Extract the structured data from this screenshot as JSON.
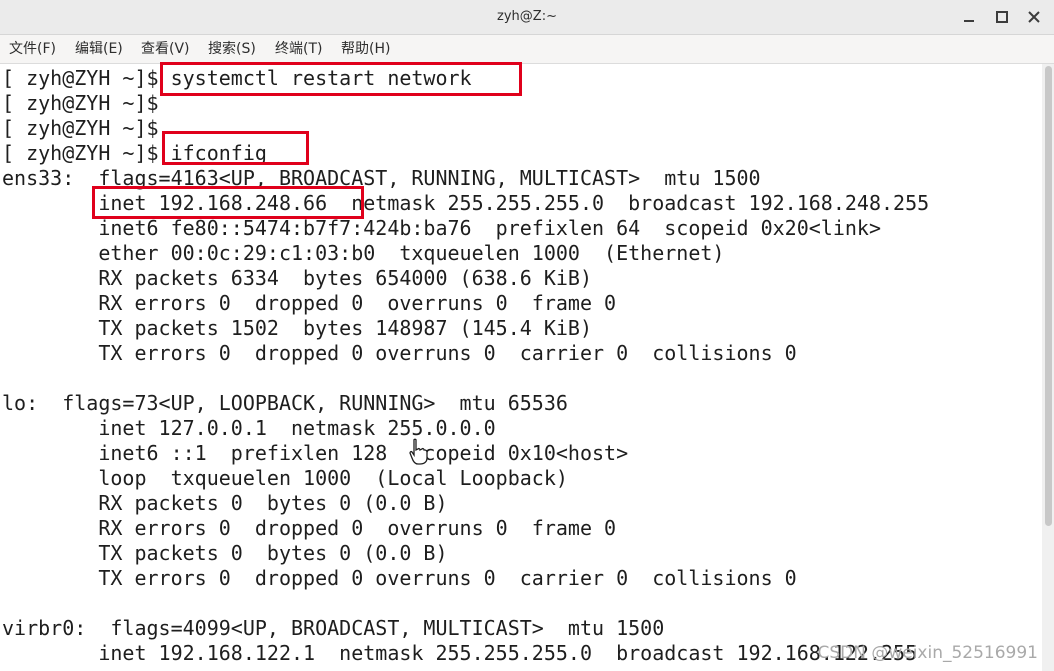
{
  "window": {
    "title": "zyh@Z:~"
  },
  "menu": [
    "文件(F)",
    "编辑(E)",
    "查看(V)",
    "搜索(S)",
    "终端(T)",
    "帮助(H)"
  ],
  "terminal": {
    "lines": [
      "[ zyh@ZYH ~]$ systemctl restart network",
      "[ zyh@ZYH ~]$",
      "[ zyh@ZYH ~]$",
      "[ zyh@ZYH ~]$ ifconfig",
      "ens33:  flags=4163<UP, BROADCAST, RUNNING, MULTICAST>  mtu 1500",
      "        inet 192.168.248.66  netmask 255.255.255.0  broadcast 192.168.248.255",
      "        inet6 fe80::5474:b7f7:424b:ba76  prefixlen 64  scopeid 0x20<link>",
      "        ether 00:0c:29:c1:03:b0  txqueuelen 1000  (Ethernet)",
      "        RX packets 6334  bytes 654000 (638.6 KiB)",
      "        RX errors 0  dropped 0  overruns 0  frame 0",
      "        TX packets 1502  bytes 148987 (145.4 KiB)",
      "        TX errors 0  dropped 0 overruns 0  carrier 0  collisions 0",
      "",
      "lo:  flags=73<UP, LOOPBACK, RUNNING>  mtu 65536",
      "        inet 127.0.0.1  netmask 255.0.0.0",
      "        inet6 ::1  prefixlen 128  scopeid 0x10<host>",
      "        loop  txqueuelen 1000  (Local Loopback)",
      "        RX packets 0  bytes 0 (0.0 B)",
      "        RX errors 0  dropped 0  overruns 0  frame 0",
      "        TX packets 0  bytes 0 (0.0 B)",
      "        TX errors 0  dropped 0 overruns 0  carrier 0  collisions 0",
      "",
      "virbr0:  flags=4099<UP, BROADCAST, MULTICAST>  mtu 1500",
      "        inet 192.168.122.1  netmask 255.255.255.0  broadcast 192.168.122.255"
    ]
  },
  "watermark": "CSDN @weixin_52516991",
  "colors": {
    "highlight": "#e0001b",
    "text": "#1e1e1e",
    "titlebar": "#ebebeb"
  },
  "icons": [
    "minimize-icon",
    "maximize-icon",
    "close-icon",
    "mouse-cursor-icon"
  ]
}
